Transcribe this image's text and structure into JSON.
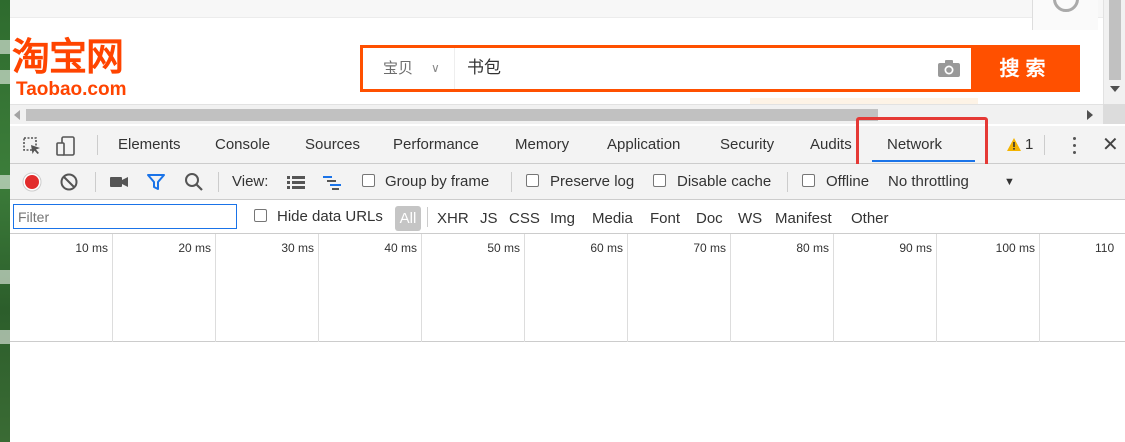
{
  "page": {
    "logo_cn": "淘宝网",
    "logo_en": "Taobao.com",
    "search": {
      "scope": "宝贝",
      "query": "书包",
      "button": "搜索",
      "colors": {
        "brand": "#ff5000"
      }
    }
  },
  "devtools": {
    "tabs": [
      {
        "label": "Elements"
      },
      {
        "label": "Console"
      },
      {
        "label": "Sources"
      },
      {
        "label": "Performance"
      },
      {
        "label": "Memory"
      },
      {
        "label": "Application"
      },
      {
        "label": "Security"
      },
      {
        "label": "Audits"
      },
      {
        "label": "Network",
        "active": true
      }
    ],
    "warning_count": "1",
    "toolbar": {
      "view_label": "View:",
      "group_by_frame": "Group by frame",
      "preserve_log": "Preserve log",
      "disable_cache": "Disable cache",
      "offline": "Offline",
      "throttling": "No throttling"
    },
    "filter": {
      "placeholder": "Filter",
      "hide_data_urls": "Hide data URLs",
      "types": [
        "All",
        "XHR",
        "JS",
        "CSS",
        "Img",
        "Media",
        "Font",
        "Doc",
        "WS",
        "Manifest",
        "Other"
      ]
    },
    "timeline": {
      "ticks": [
        "10 ms",
        "20 ms",
        "30 ms",
        "40 ms",
        "50 ms",
        "60 ms",
        "70 ms",
        "80 ms",
        "90 ms",
        "100 ms",
        "110"
      ]
    },
    "colors": {
      "record": "#e22c2c",
      "accent": "#1a73e8",
      "highlight_box": "#e53935"
    }
  }
}
